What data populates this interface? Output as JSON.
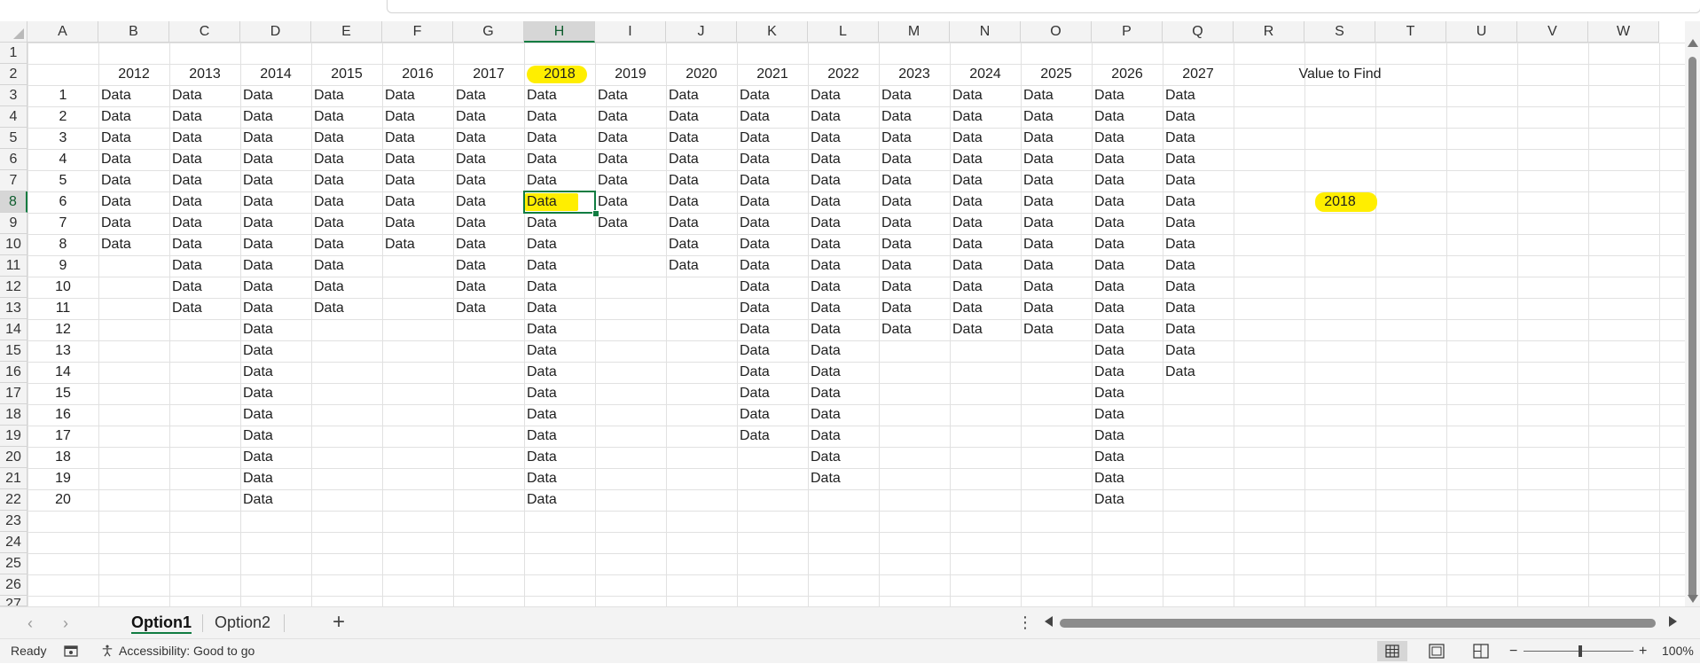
{
  "sheet": {
    "column_letters": [
      "A",
      "B",
      "C",
      "D",
      "E",
      "F",
      "G",
      "H",
      "I",
      "J",
      "K",
      "L",
      "M",
      "N",
      "O",
      "P",
      "Q",
      "R",
      "S",
      "T",
      "U",
      "V",
      "W"
    ],
    "selected_column": "H",
    "row_count_visible": 26,
    "partial_row_label": "27",
    "selected_row": 8,
    "years": [
      "2012",
      "2013",
      "2014",
      "2015",
      "2016",
      "2017",
      "2018",
      "2019",
      "2020",
      "2021",
      "2022",
      "2023",
      "2024",
      "2025",
      "2026",
      "2027"
    ],
    "highlighted_year": "2018",
    "index_labels": [
      "1",
      "2",
      "3",
      "4",
      "5",
      "6",
      "7",
      "8",
      "9",
      "10",
      "11",
      "12",
      "13",
      "14",
      "15",
      "16",
      "17",
      "18",
      "19",
      "20"
    ],
    "data_label": "Data",
    "data_counts_per_year": [
      8,
      11,
      20,
      11,
      8,
      11,
      20,
      7,
      9,
      17,
      19,
      12,
      12,
      12,
      20,
      14
    ],
    "active_cell": "H8",
    "lookup_label": "Value to Find",
    "lookup_value": "2018",
    "highlight_color": "#ffee00",
    "accent_color": "#107c41"
  },
  "tabs": {
    "items": [
      {
        "label": "Option1",
        "active": true
      },
      {
        "label": "Option2",
        "active": false
      }
    ],
    "add_symbol": "+",
    "more_symbol": "⋮",
    "prev_symbol": "‹",
    "next_symbol": "›"
  },
  "status": {
    "ready": "Ready",
    "accessibility": "Accessibility: Good to go",
    "zoom_minus": "−",
    "zoom_plus": "+",
    "zoom_level": "100%"
  }
}
